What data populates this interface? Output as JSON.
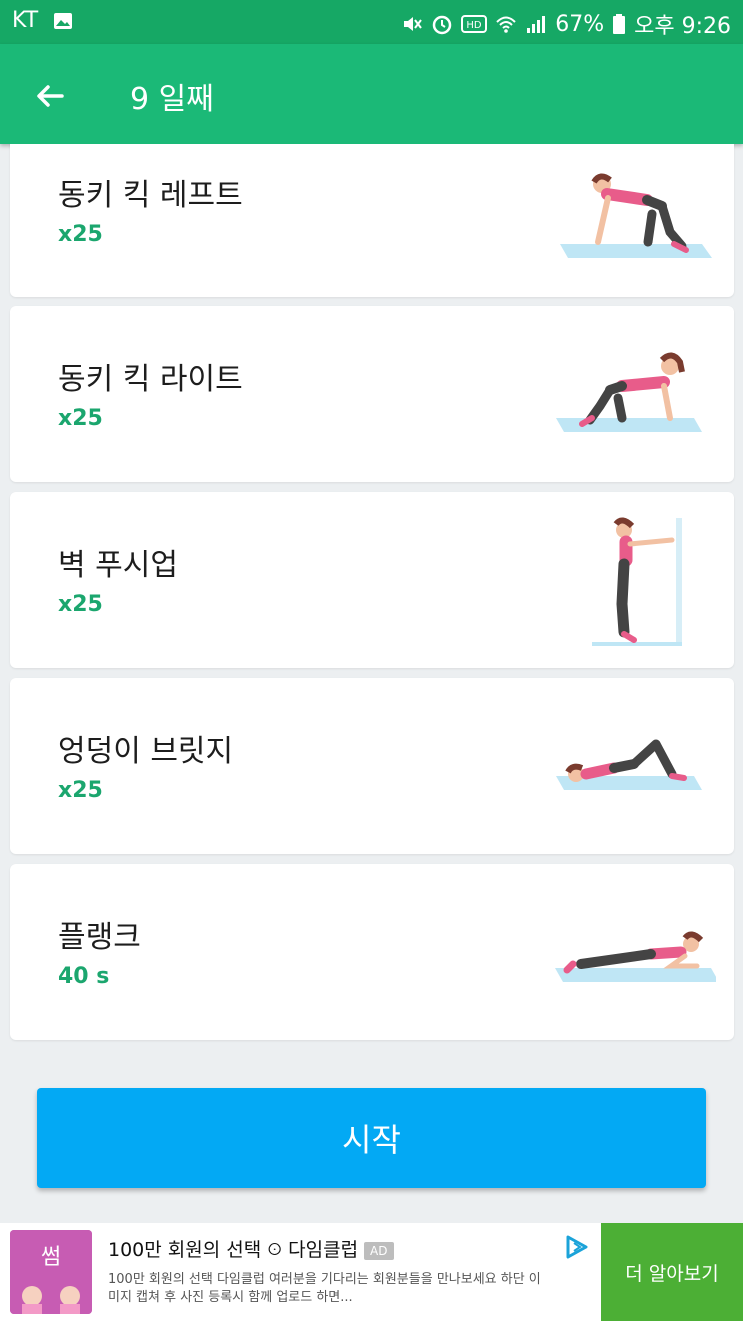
{
  "status_bar": {
    "carrier": "KT",
    "battery": "67%",
    "time": "오후 9:26",
    "icons": [
      "image-icon",
      "mute-icon",
      "alarm-icon",
      "hd-icon",
      "wifi-icon",
      "signal-icon",
      "battery-icon"
    ]
  },
  "app_bar": {
    "title": "9 일째",
    "back_icon": "arrow-left-icon"
  },
  "exercises": [
    {
      "name": "동키 킥 레프트",
      "reps": "x25",
      "illustration": "donkey-kick-left"
    },
    {
      "name": "동키 킥 라이트",
      "reps": "x25",
      "illustration": "donkey-kick-right"
    },
    {
      "name": "벽 푸시업",
      "reps": "x25",
      "illustration": "wall-pushup"
    },
    {
      "name": "엉덩이 브릿지",
      "reps": "x25",
      "illustration": "glute-bridge"
    },
    {
      "name": "플랭크",
      "reps": "40 s",
      "illustration": "plank"
    }
  ],
  "start_button": {
    "label": "시작"
  },
  "ad": {
    "logo_text": "썸",
    "title": "100만 회원의 선택 ꖴ 다임클럽",
    "badge": "AD",
    "description": "100만 회원의 선택 다임클럽 여러분을 기다리는 회원분들을 만나보세요 하단 이미지 캡쳐 후 사진 등록시 함께 업로드 하면...",
    "cta": "더 알아보기"
  },
  "colors": {
    "status_bar": "#16A865",
    "app_bar": "#1BB977",
    "reps_text": "#1BA66E",
    "start_button": "#03A9F4",
    "ad_cta": "#4CAF35",
    "background": "#ECEFF1"
  }
}
